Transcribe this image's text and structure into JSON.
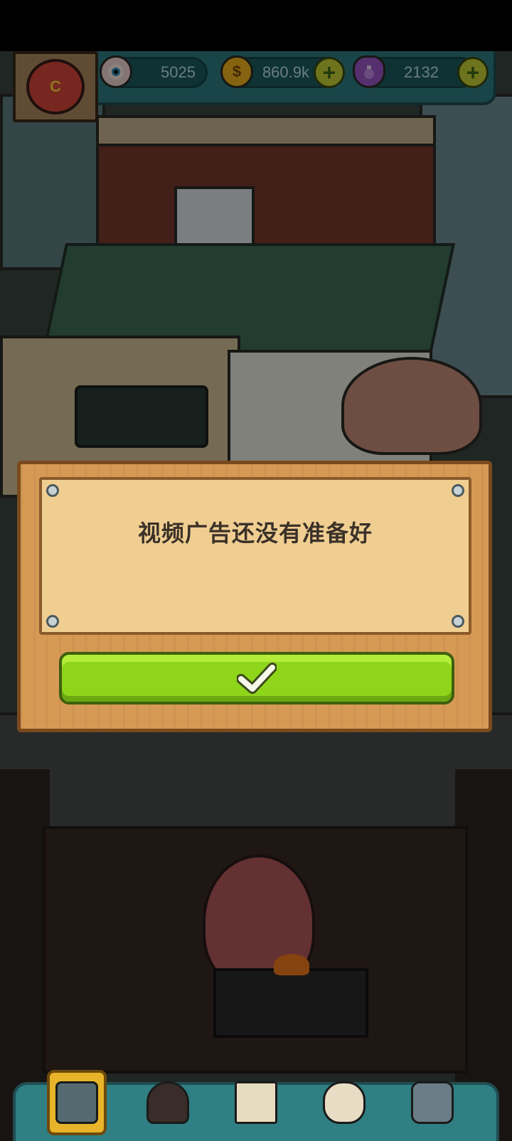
{
  "hud": {
    "eyeballs": {
      "value": "5025",
      "icon": "eyeball-icon"
    },
    "coins": {
      "value": "860.9k",
      "icon": "coin-icon"
    },
    "potions": {
      "value": "2132",
      "icon": "potion-icon"
    },
    "avatar_letter": "C"
  },
  "dialog": {
    "message": "视频广告还没有准备好",
    "confirm_icon": "checkmark-icon"
  },
  "bottom_nav": [
    {
      "id": "shop",
      "icon": "shop-icon"
    },
    {
      "id": "furnace",
      "icon": "furnace-icon"
    },
    {
      "id": "recipes",
      "icon": "book-icon"
    },
    {
      "id": "bag",
      "icon": "money-bag-icon"
    },
    {
      "id": "menu",
      "icon": "grid-menu-icon"
    }
  ],
  "colors": {
    "hud": "#2f7f83",
    "confirm_button": "#8fd61b",
    "dialog_wood": "#d79a55",
    "dialog_paper": "#f0ce91"
  }
}
